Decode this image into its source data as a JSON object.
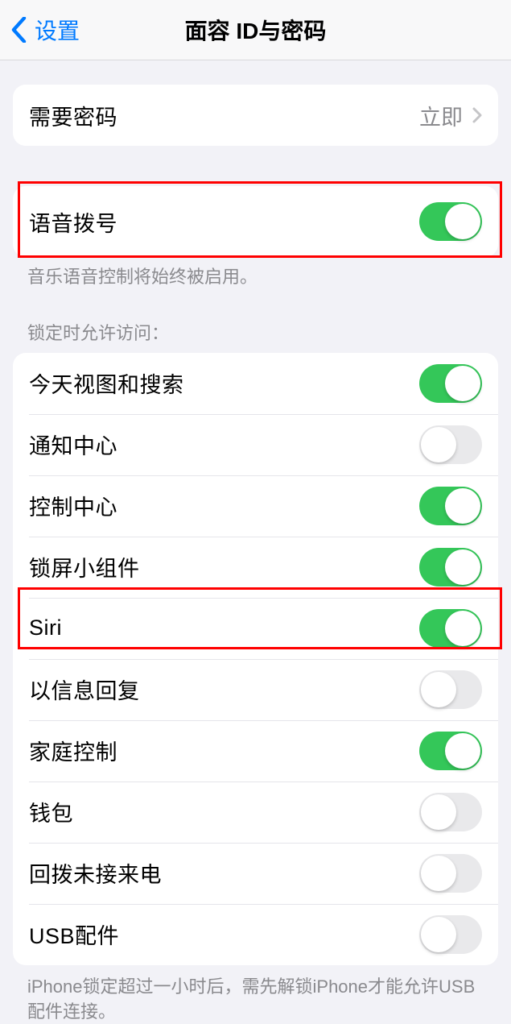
{
  "nav": {
    "back_label": "设置",
    "title": "面容 ID与密码"
  },
  "require_passcode": {
    "label": "需要密码",
    "value": "立即"
  },
  "voice_dial": {
    "label": "语音拨号",
    "footer": "音乐语音控制将始终被启用。"
  },
  "lock_access": {
    "header": "锁定时允许访问：",
    "items": [
      {
        "label": "今天视图和搜索",
        "on": true
      },
      {
        "label": "通知中心",
        "on": false
      },
      {
        "label": "控制中心",
        "on": true
      },
      {
        "label": "锁屏小组件",
        "on": true
      },
      {
        "label": "Siri",
        "on": true
      },
      {
        "label": "以信息回复",
        "on": false
      },
      {
        "label": "家庭控制",
        "on": true
      },
      {
        "label": "钱包",
        "on": false
      },
      {
        "label": "回拨未接来电",
        "on": false
      },
      {
        "label": "USB配件",
        "on": false
      }
    ],
    "footer": "iPhone锁定超过一小时后，需先解锁iPhone才能允许USB配件连接。"
  }
}
